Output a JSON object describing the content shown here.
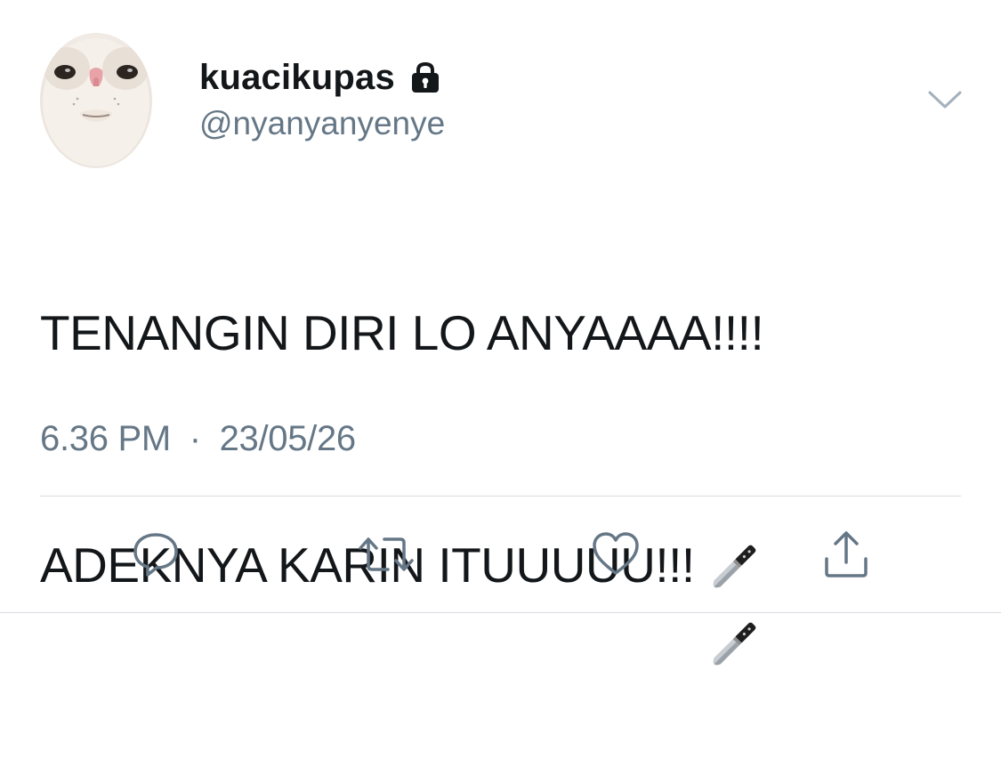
{
  "tweet": {
    "display_name": "kuacikupas",
    "handle": "@nyanyanyenye",
    "is_protected": true,
    "text_line_1": "TENANGIN DIRI LO ANYAAAA!!!!",
    "text_line_2": "ADEKNYA KARIN ITUUUUU!!!",
    "emoji": [
      "kitchen-knife",
      "kitchen-knife"
    ],
    "time": "6.36 PM",
    "separator": "·",
    "date": "23/05/26"
  },
  "actions": [
    {
      "name": "reply",
      "icon": "reply-bubble-icon"
    },
    {
      "name": "retweet",
      "icon": "retweet-icon"
    },
    {
      "name": "like",
      "icon": "heart-icon"
    },
    {
      "name": "share",
      "icon": "share-icon"
    }
  ],
  "colors": {
    "text": "#14171a",
    "secondary": "#657786",
    "icon": "#657786",
    "divider": "#d7dde2"
  }
}
